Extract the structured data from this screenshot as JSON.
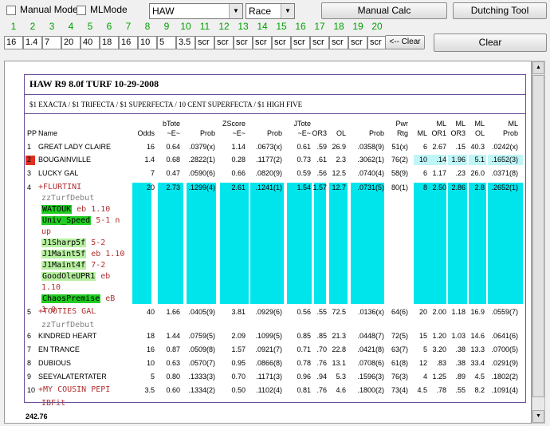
{
  "toolbar": {
    "manual_mode": "Manual Mode",
    "ml_mode": "MLMode",
    "track_value": "HAW",
    "race_value": "Race",
    "manual_calc": "Manual Calc",
    "dutching_tool": "Dutching Tool",
    "clear_row_label": "<-- Clear",
    "clear_label": "Clear"
  },
  "numbers": [
    "1",
    "2",
    "3",
    "4",
    "5",
    "6",
    "7",
    "8",
    "9",
    "10",
    "11",
    "12",
    "13",
    "14",
    "15",
    "16",
    "17",
    "18",
    "19",
    "20"
  ],
  "inputs": [
    "16",
    "1.4",
    "7",
    "20",
    "40",
    "18",
    "16",
    "10",
    "5",
    "3.5",
    "scr",
    "scr",
    "scr",
    "scr",
    "scr",
    "scr",
    "scr",
    "scr",
    "scr",
    "scr"
  ],
  "report": {
    "title": "HAW R9 8.0f TURF 10-29-2008",
    "wagers": "$1 EXACTA / $1 TRIFECTA / $1 SUPERFECTA / 10 CENT SUPERFECTA / $1 HIGH FIVE",
    "headers": {
      "pp": "PP",
      "name": "Name",
      "odds": "Odds",
      "btote1": "bTote",
      "btote2": "~E~",
      "prob": "Prob",
      "zscore1": "ZScore",
      "zscore2": "~E~",
      "jtote1": "JTote",
      "jtote2": "~E~",
      "or3": "OR3",
      "ol": "OL",
      "pwr1": "Pwr",
      "pwr2": "Rtg",
      "ml": "ML",
      "mlor1_1": "ML",
      "mlor1_2": "OR1",
      "mlor3_1": "ML",
      "mlor3_2": "OR3",
      "mlol1": "ML",
      "mlol2": "OL",
      "mlprob1": "ML",
      "mlprob2": "Prob"
    },
    "rows": [
      {
        "pp": "1",
        "name": "GREAT LADY CLAIRE",
        "odds": "16",
        "bt": "0.64",
        "bp": ".0379(x)",
        "zs": "1.14",
        "zp": ".0673(x)",
        "jt": "0.61",
        "or3": ".59",
        "ol": "26.9",
        "jp": ".0358(9)",
        "pwr": "51(x)",
        "ml": "6",
        "mor1": "2.67",
        "mor3": ".15",
        "mol": "40.3",
        "mp": ".0242(x)"
      },
      {
        "pp": "2",
        "name": "BOUGAINVILLE",
        "odds": "1.4",
        "bt": "0.68",
        "bp": ".2822(1)",
        "zs": "0.28",
        "zp": ".1177(2)",
        "jt": "0.73",
        "or3": ".61",
        "ol": "2.3",
        "jp": ".3062(1)",
        "pwr": "76(2)",
        "ml": "10",
        "mor1": ".14",
        "mor3": "1.96",
        "mol": "5.1",
        "mp": ".1652(3)"
      },
      {
        "pp": "3",
        "name": "LUCKY GAL",
        "odds": "7",
        "bt": "0.47",
        "bp": ".0590(6)",
        "zs": "0.66",
        "zp": ".0820(9)",
        "jt": "0.59",
        "or3": ".56",
        "ol": "12.5",
        "jp": ".0740(4)",
        "pwr": "58(9)",
        "ml": "6",
        "mor1": "1.17",
        "mor3": ".23",
        "mol": "26.0",
        "mp": ".0371(8)"
      },
      {
        "pp": "4",
        "name": "+FLURTINI",
        "odds": "20",
        "bt": "2.73",
        "bp": ".1299(4)",
        "zs": "2.61",
        "zp": ".1241(1)",
        "jt": "1.54",
        "or3": "1.57",
        "ol": "12.7",
        "jp": ".0731(5)",
        "pwr": "80(1)",
        "ml": "8",
        "mor1": "2.50",
        "mor3": "2.86",
        "mol": "2.8",
        "mp": ".2652(1)"
      },
      {
        "pp": "5",
        "name": "+TOOTIES GAL",
        "odds": "40",
        "bt": "1.66",
        "bp": ".0405(9)",
        "zs": "3.81",
        "zp": ".0929(6)",
        "jt": "0.56",
        "or3": ".55",
        "ol": "72.5",
        "jp": ".0136(x)",
        "pwr": "64(6)",
        "ml": "20",
        "mor1": "2.00",
        "mor3": "1.18",
        "mol": "16.9",
        "mp": ".0559(7)"
      },
      {
        "pp": "6",
        "name": "KINDRED HEART",
        "odds": "18",
        "bt": "1.44",
        "bp": ".0759(5)",
        "zs": "2.09",
        "zp": ".1099(5)",
        "jt": "0.85",
        "or3": ".85",
        "ol": "21.3",
        "jp": ".0448(7)",
        "pwr": "72(5)",
        "ml": "15",
        "mor1": "1.20",
        "mor3": "1.03",
        "mol": "14.6",
        "mp": ".0641(6)"
      },
      {
        "pp": "7",
        "name": "EN TRANCE",
        "odds": "16",
        "bt": "0.87",
        "bp": ".0509(8)",
        "zs": "1.57",
        "zp": ".0921(7)",
        "jt": "0.71",
        "or3": ".70",
        "ol": "22.8",
        "jp": ".0421(8)",
        "pwr": "63(7)",
        "ml": "5",
        "mor1": "3.20",
        "mor3": ".38",
        "mol": "13.3",
        "mp": ".0700(5)"
      },
      {
        "pp": "8",
        "name": "DUBIOUS",
        "odds": "10",
        "bt": "0.63",
        "bp": ".0570(7)",
        "zs": "0.95",
        "zp": ".0866(8)",
        "jt": "0.78",
        "or3": ".76",
        "ol": "13.1",
        "jp": ".0708(6)",
        "pwr": "61(8)",
        "ml": "12",
        "mor1": ".83",
        "mor3": ".38",
        "mol": "33.4",
        "mp": ".0291(9)"
      },
      {
        "pp": "9",
        "name": "SEEYALATERTATER",
        "odds": "5",
        "bt": "0.80",
        "bp": ".1333(3)",
        "zs": "0.70",
        "zp": ".1171(3)",
        "jt": "0.96",
        "or3": ".94",
        "ol": "5.3",
        "jp": ".1596(3)",
        "pwr": "76(3)",
        "ml": "4",
        "mor1": "1.25",
        "mor3": ".89",
        "mol": "4.5",
        "mp": ".1802(2)"
      },
      {
        "pp": "10",
        "name": "+MY COUSIN PEPI",
        "odds": "3.5",
        "bt": "0.60",
        "bp": ".1334(2)",
        "zs": "0.50",
        "zp": ".1102(4)",
        "jt": "0.81",
        "or3": ".76",
        "ol": "4.6",
        "jp": ".1800(2)",
        "pwr": "73(4)",
        "ml": "4.5",
        "mor1": ".78",
        "mor3": ".55",
        "mol": "8.2",
        "mp": ".1091(4)"
      }
    ],
    "flurtini_notes": {
      "n1": "zzTurfDebut",
      "watouk": "WATOUK",
      "watouk_tag": " eb 1.10",
      "univ": "Univ_Speed",
      "univ_tag": " 5-1 n",
      "univ_tag2": "up",
      "j1sharp": "J1Sharp5f",
      "j1sharp_tag": " 5-2",
      "j1maint5": "J1Maint5f",
      "j1maint5_tag": " eb 1.10",
      "j1maint4": "J1Maint4f",
      "j1maint4_tag": " 7-2",
      "goodole": "GoodOleUPR1",
      "goodole_tag": " eb",
      "goodole_tag2": "1.10",
      "chaos": "ChaosPremise",
      "chaos_tag": " eB",
      "chaos_tag2": "1.0"
    },
    "tooties_note": "zzTurfDebut",
    "pepi_note": "IBFit",
    "footer": "242.76"
  }
}
